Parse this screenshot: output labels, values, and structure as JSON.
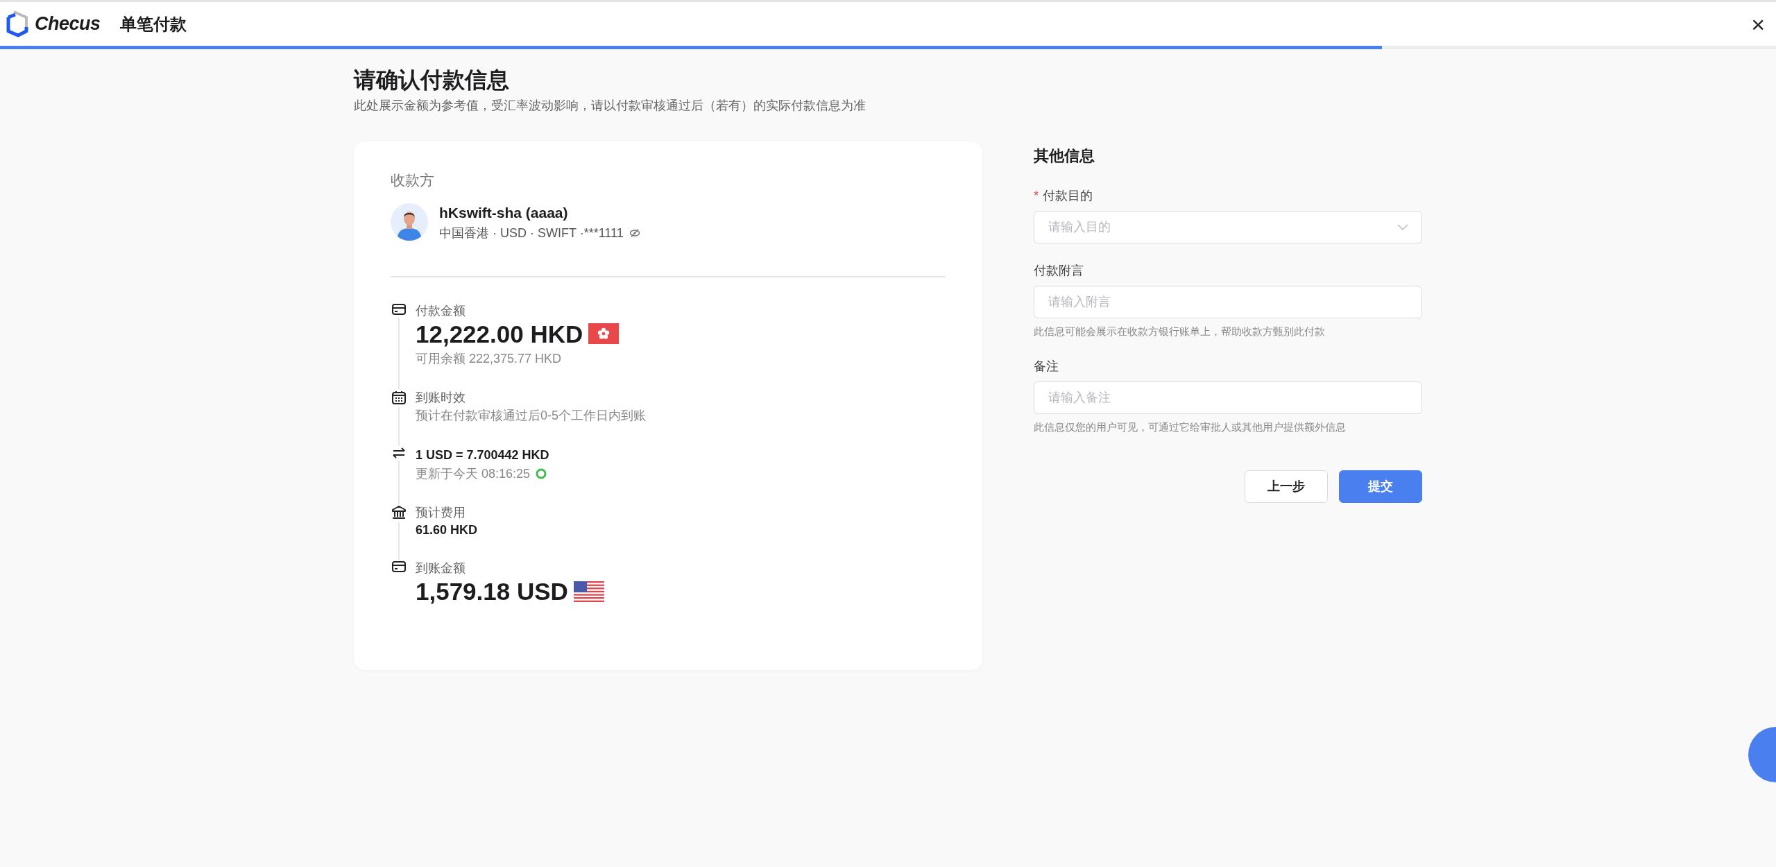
{
  "header": {
    "logo_text": "Checus",
    "title": "单笔付款",
    "close": "×"
  },
  "progress": {
    "level": 0.778
  },
  "page": {
    "title": "请确认付款信息",
    "subtitle": "此处展示金额为参考值，受汇率波动影响，请以付款审核通过后（若有）的实际付款信息为准"
  },
  "payee": {
    "label": "收款方",
    "name": "hKswift-sha (aaaa)",
    "details": "中国香港 · USD · SWIFT ·***1111",
    "masked": true
  },
  "timeline": [
    {
      "kind": "payment",
      "label": "付款金额",
      "value": "12,222.00 HKD",
      "note": "可用余额 222,375.77 HKD"
    },
    {
      "kind": "timing",
      "label": "到账时效",
      "note": "预计在付款审核通过后0-5个工作日内到账"
    },
    {
      "kind": "rate",
      "value": "1 USD = 7.700442 HKD",
      "note": "更新于今天 08:16:25",
      "live": true
    },
    {
      "kind": "fee",
      "label": "预计费用",
      "value": "61.60 HKD"
    },
    {
      "kind": "received",
      "label": "到账金额",
      "value": "1,579.18 USD"
    }
  ],
  "form": {
    "title": "其他信息",
    "fields": [
      {
        "kind": "select",
        "marker": "*",
        "label": "付款目的",
        "placeholder": "请输入目的"
      },
      {
        "kind": "input",
        "label": "付款附言",
        "placeholder": "请输入附言",
        "help": "此信息可能会展示在收款方银行账单上，帮助收款方甄别此付款"
      },
      {
        "kind": "input",
        "label": "备注",
        "placeholder": "请输入备注",
        "help": "此信息仅您的用户可见，可通过它给审批人或其他用户提供额外信息"
      }
    ],
    "buttons": [
      {
        "label": "上一步",
        "kind": "secondary"
      },
      {
        "label": "提交",
        "kind": "primary"
      }
    ]
  }
}
